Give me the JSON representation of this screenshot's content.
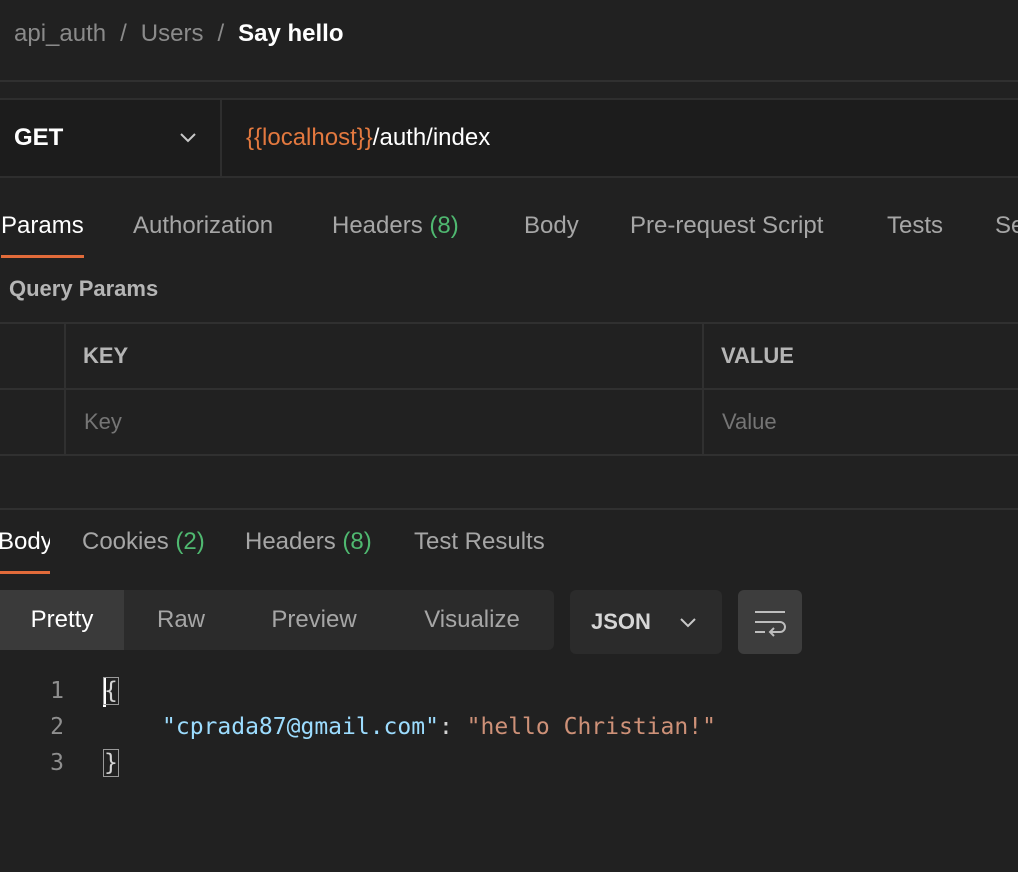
{
  "breadcrumb": {
    "collection": "api_auth",
    "folder": "Users",
    "request": "Say hello",
    "separator": "/"
  },
  "request": {
    "method": "GET",
    "url_variable": "{{localhost}}",
    "url_path": "/auth/index"
  },
  "request_tabs": [
    {
      "label": "Params",
      "active": true
    },
    {
      "label": "Authorization"
    },
    {
      "label": "Headers",
      "count": "(8)"
    },
    {
      "label": "Body"
    },
    {
      "label": "Pre-request Script"
    },
    {
      "label": "Tests"
    },
    {
      "label": "Se"
    }
  ],
  "query_params": {
    "title": "Query Params",
    "columns": [
      "KEY",
      "VALUE"
    ],
    "placeholders": {
      "key": "Key",
      "value": "Value"
    }
  },
  "response_tabs": [
    {
      "label": "Body",
      "active": true
    },
    {
      "label": "Cookies",
      "count": "(2)"
    },
    {
      "label": "Headers",
      "count": "(8)"
    },
    {
      "label": "Test Results"
    }
  ],
  "format": {
    "modes": [
      "Pretty",
      "Raw",
      "Preview",
      "Visualize"
    ],
    "active_mode": "Pretty",
    "language": "JSON"
  },
  "response_body": {
    "line_numbers": [
      "1",
      "2",
      "3"
    ],
    "open_brace": "{",
    "close_brace": "}",
    "key": "\"cprada87@gmail.com\"",
    "colon": ":",
    "value": "\"hello Christian!\""
  },
  "icons": {
    "method_dropdown": "chevron-down-icon",
    "language_dropdown": "chevron-down-icon",
    "wrap": "wrap-lines-icon"
  },
  "colors": {
    "background": "#212121",
    "accent": "#e26b3a",
    "count": "#4fb870",
    "url_variable": "#e3793f",
    "json_key": "#9cdcfe",
    "json_string": "#ce9178"
  }
}
